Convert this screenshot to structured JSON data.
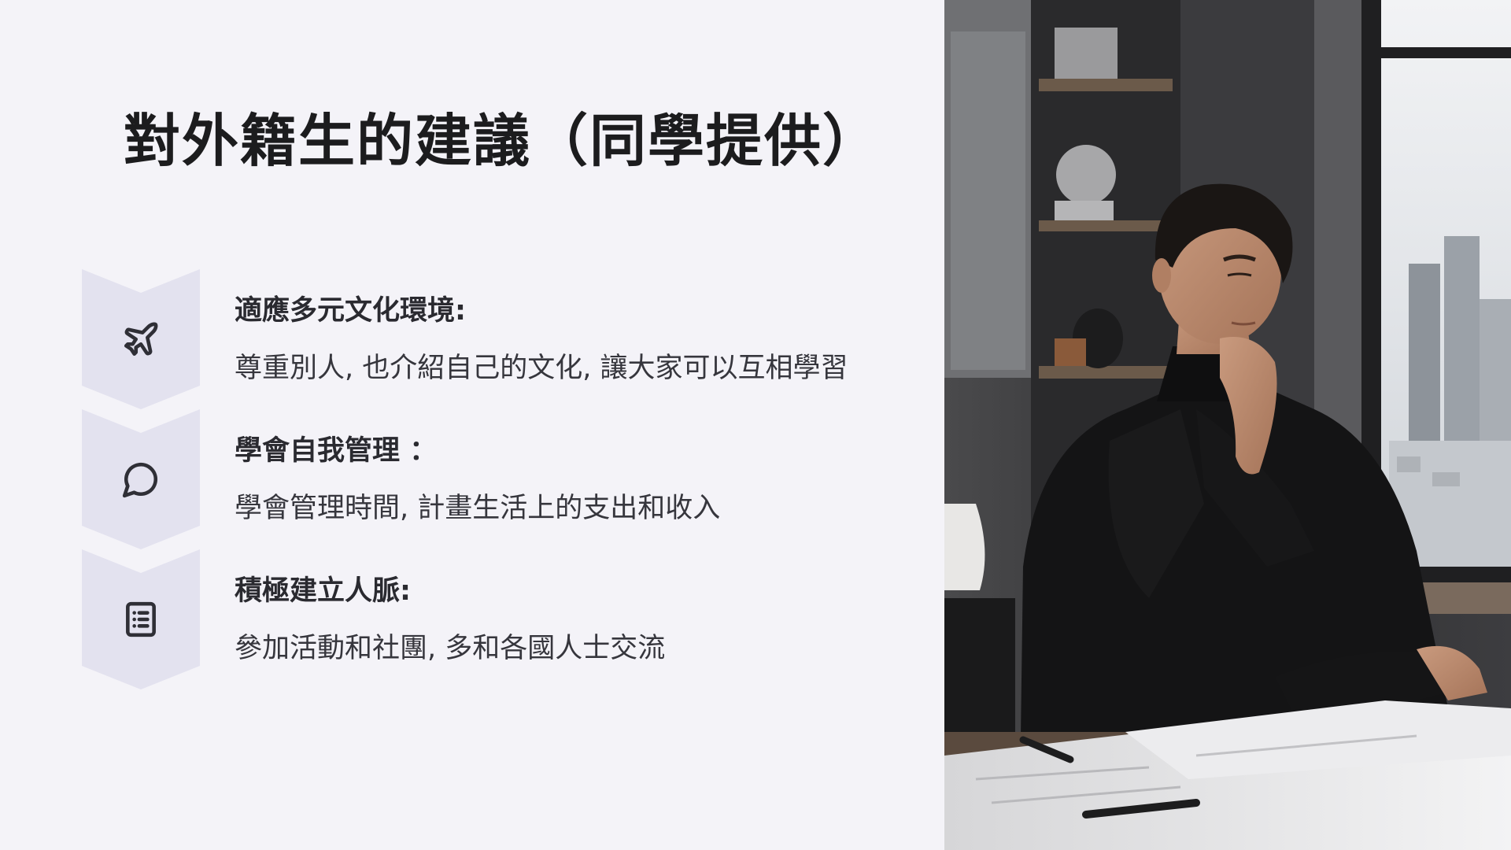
{
  "slide": {
    "title": "對外籍生的建議（同學提供）"
  },
  "items": [
    {
      "icon": "airplane-icon",
      "heading": "適應多元文化環境:",
      "body": "尊重別人, 也介紹自己的文化, 讓大家可以互相學習"
    },
    {
      "icon": "chat-bubble-icon",
      "heading": "學會自我管理 ：",
      "body": "學會管理時間, 計畫生活上的支出和收入"
    },
    {
      "icon": "list-icon",
      "heading": "積極建立人脈:",
      "body": "參加活動和社團, 多和各國人士交流"
    }
  ],
  "colors": {
    "background": "#f4f3f8",
    "chevron": "#e3e2ef",
    "title": "#1c1c1e",
    "text": "#36363d"
  },
  "photo": {
    "subject": "man-in-black-turtleneck-thinking-at-desk-by-window"
  }
}
